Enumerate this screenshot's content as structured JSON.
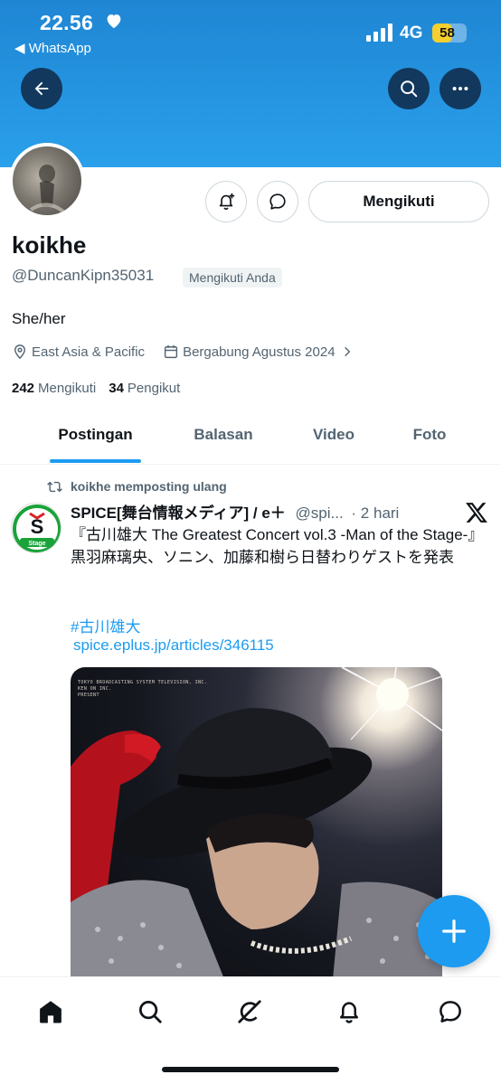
{
  "status_bar": {
    "time": "22.56",
    "back_app": "◀ WhatsApp",
    "network": "4G",
    "battery": "58",
    "battery_level": 0.58
  },
  "header": {
    "back_icon": "arrow-left-icon",
    "search_icon": "search-icon",
    "more_icon": "more-horizontal-icon"
  },
  "profile": {
    "display_name": "koikhe",
    "handle": "@DuncanKipn35031",
    "follows_you": "Mengikuti Anda",
    "bio": "She/her",
    "location": "East Asia & Pacific",
    "joined": "Bergabung Agustus 2024",
    "following_count": "242",
    "following_label": "Mengikuti",
    "followers_count": "34",
    "followers_label": "Pengikut",
    "follow_button": "Mengikuti"
  },
  "tabs": [
    {
      "label": "Postingan",
      "active": true
    },
    {
      "label": "Balasan",
      "active": false
    },
    {
      "label": "Video",
      "active": false
    },
    {
      "label": "Foto",
      "active": false
    }
  ],
  "post": {
    "repost_label": "koikhe memposting ulang",
    "author_name": "SPICE[舞台情報メディア] / e＋",
    "author_handle": "@spi...",
    "time": "· 2 hari",
    "text": "『古川雄大 The Greatest Concert vol.3 -Man of the Stage-』黒羽麻璃央、ソニン、加藤和樹ら日替わりゲストを発表",
    "hashtag": "#古川雄大",
    "link": "spice.eplus.jp/articles/346115",
    "media_caption": "TOKYO BROADCASTING SYSTEM TELEVISION, INC.\nKEN ON INC.\nPRESENT",
    "avatar_letter": "S",
    "avatar_label": "Stage",
    "avatar_color": "#1aa33a"
  },
  "colors": {
    "accent": "#1d9bf0",
    "banner": "#2aa0ea"
  },
  "nav": {
    "items": [
      "home-icon",
      "search-icon",
      "grok-icon",
      "notifications-icon",
      "messages-icon"
    ]
  }
}
